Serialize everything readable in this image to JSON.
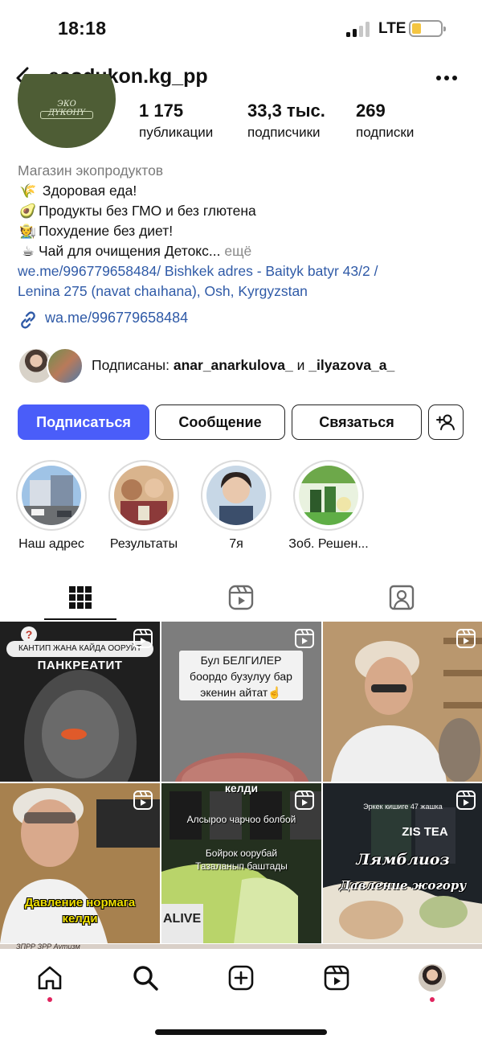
{
  "status_bar": {
    "time": "18:18",
    "network": "LTE",
    "battery_color": "#f4c542"
  },
  "header": {
    "username": "ecodukon.kg_pp",
    "back_icon": "chevron-left-icon",
    "more_icon": "more-horizontal-icon"
  },
  "avatar": {
    "logo_text": "ЭКО ДҮКӨНҮ"
  },
  "stats": [
    {
      "value": "1 175",
      "label": "публикации"
    },
    {
      "value": "33,3 тыс.",
      "label": "подписчики"
    },
    {
      "value": "269",
      "label": "подписки"
    }
  ],
  "bio": {
    "category": "Магазин экопродуктов",
    "lines": [
      {
        "emoji": "🌾",
        "text": "Здоровая еда!"
      },
      {
        "emoji": "🥑",
        "text": "Продукты без ГМО и без глютена"
      },
      {
        "emoji": "🧑‍🌾",
        "text": "Похудение без диет!"
      },
      {
        "emoji": "☕",
        "text": "Чай для очищения Детокс..."
      }
    ],
    "more": "ещё",
    "address_line1": "we.me/996779658484/ Bishkek adres - Baityk batyr 43/2 /",
    "address_line2": "Lenina 275 (navat chaıhana), Osh, Kyrgyzstan",
    "link": "wa.me/996779658484"
  },
  "followed_by": {
    "prefix": "Подписаны:",
    "user1": "anar_anarkulova_",
    "conj": "и",
    "user2": "_ilyazova_a_"
  },
  "buttons": {
    "follow": "Подписаться",
    "message": "Сообщение",
    "contact": "Связаться",
    "add_user_icon": "add-person-icon",
    "follow_color": "#4a5df9"
  },
  "highlights": [
    {
      "label": "Наш адрес"
    },
    {
      "label": "Результаты"
    },
    {
      "label": "7я"
    },
    {
      "label": "Зоб. Решен..."
    }
  ],
  "tabs": [
    {
      "name": "grid-icon",
      "active": true
    },
    {
      "name": "reels-icon",
      "active": false
    },
    {
      "name": "tagged-icon",
      "active": false
    }
  ],
  "posts": [
    {
      "badge": "?",
      "line1": "КАНТИП ЖАНА КАЙДА ООРУЙТ",
      "line2": "ПАНКРЕАТИТ"
    },
    {
      "line1": "Бул БЕЛГИЛЕР",
      "line2": "боордо бузулуу бар",
      "line3": "экенин айтат☝️"
    },
    {},
    {
      "line1": "Давление нормага",
      "line2": "келди"
    },
    {
      "top": "келди",
      "line1": "Алсыроо чарчоо болбой",
      "line2": "Бойрок оорубай",
      "line3": "Тазаланып баштады",
      "pack": "ALIVE"
    },
    {
      "top": "Эркек кишиге 47 жашка",
      "line1": "Лямблиоз",
      "line2": "Давление жогору",
      "pack": "ZIS TEA"
    }
  ],
  "bottom_nav": [
    {
      "name": "home-icon",
      "dot": true
    },
    {
      "name": "search-icon",
      "dot": false
    },
    {
      "name": "create-icon",
      "dot": false
    },
    {
      "name": "reels-nav-icon",
      "dot": false
    },
    {
      "name": "profile-avatar",
      "dot": true
    }
  ],
  "partial_row_text": "ЗПРР ЗРР Аутизм"
}
